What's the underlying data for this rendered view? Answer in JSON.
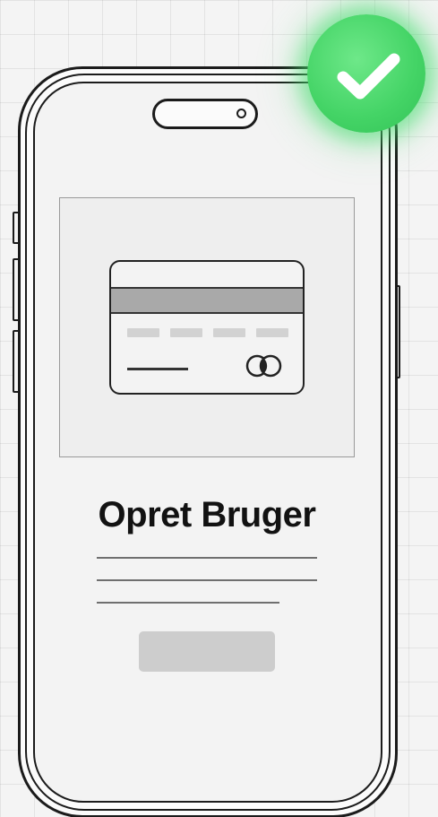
{
  "screen": {
    "title": "Opret Bruger",
    "badge_icon": "checkmark-icon",
    "card_icon": "credit-card-icon",
    "accent_color": "#44d466",
    "button_color": "#cdcdcd"
  }
}
